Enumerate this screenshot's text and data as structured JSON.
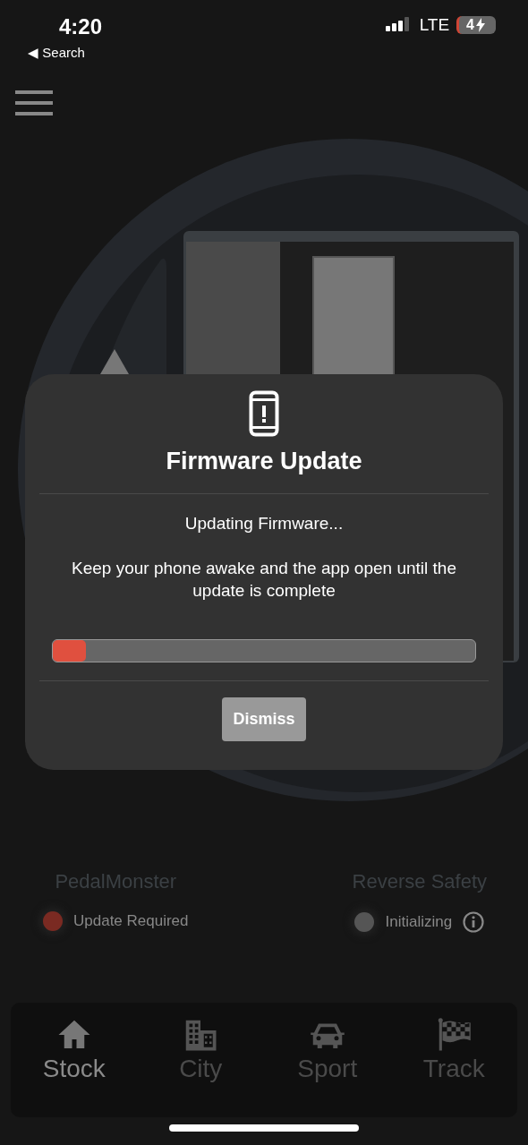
{
  "status_bar": {
    "time": "4:20",
    "back_label": "◀ Search",
    "network": "LTE",
    "battery": "4"
  },
  "modal": {
    "title": "Firmware Update",
    "status": "Updating Firmware...",
    "message": "Keep your phone awake and the app open until the update is complete",
    "progress": {
      "level": 0.078
    },
    "button": "Dismiss"
  },
  "devices": [
    {
      "name": "PedalMonster",
      "status": "Update Required",
      "color": "#7a2a22",
      "info": false
    },
    {
      "name": "Reverse Safety",
      "status": "Initializing",
      "color": "#555555",
      "info": true
    }
  ],
  "tabs": [
    {
      "label": "Stock",
      "selected": true
    },
    {
      "label": "City",
      "selected": false
    },
    {
      "label": "Sport",
      "selected": false
    },
    {
      "label": "Track",
      "selected": false
    }
  ]
}
